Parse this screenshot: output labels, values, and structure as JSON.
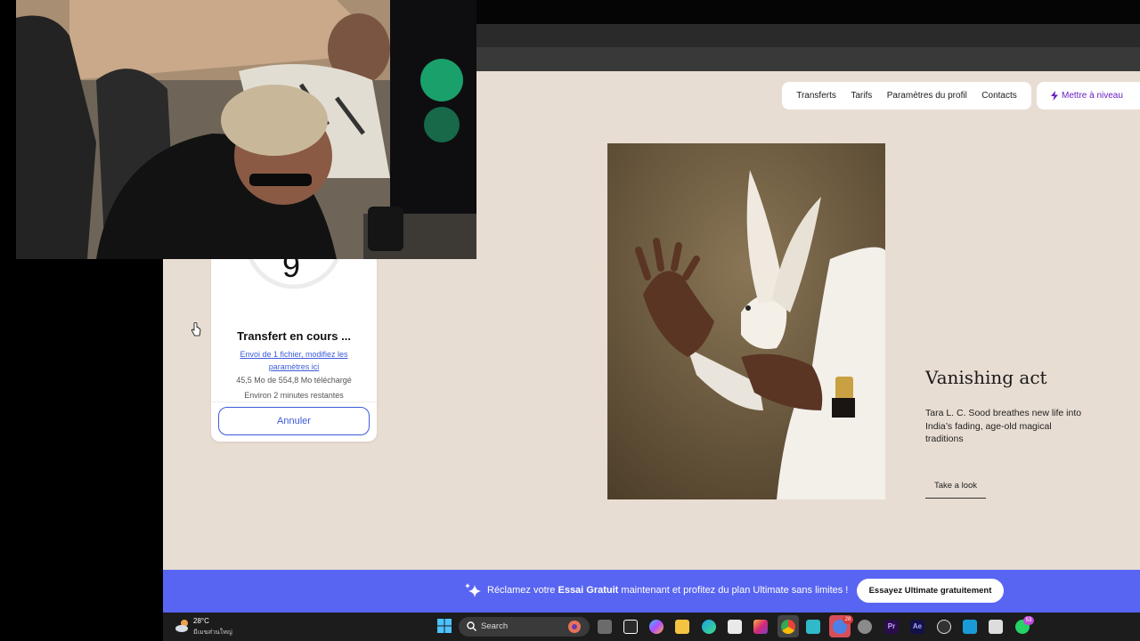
{
  "nav": {
    "items": [
      "Transferts",
      "Tarifs",
      "Paramètres du profil",
      "Contacts"
    ],
    "upgrade_label": "Mettre à niveau"
  },
  "transfer_card": {
    "percent": "9",
    "progress_fraction": 0.09,
    "title": "Transfert en cours ...",
    "link": "Envoi de 1 fichier, modifiez les paramètres ici",
    "uploaded": "45,5 Mo de 554,8 Mo téléchargé",
    "remaining": "Environ 2 minutes restantes",
    "cancel_label": "Annuler"
  },
  "article": {
    "title": "Vanishing act",
    "description": "Tara L. C. Sood breathes new life into India’s fading, age-old magical traditions",
    "cta": "Take a look"
  },
  "banner": {
    "text_before": "Réclamez votre ",
    "text_bold": "Essai Gratuit",
    "text_after": " maintenant et profitez du plan Ultimate sans limites !",
    "button_label": "Essayez Ultimate gratuitement"
  },
  "taskbar": {
    "weather_temp": "28°C",
    "weather_desc": "มีเมฆส่วนใหญ่",
    "search_placeholder": "Search",
    "whatsapp_badge": "53",
    "active_app_badge": "28"
  },
  "colors": {
    "page_bg": "#e8ddd2",
    "accent_blue": "#3d5bd9",
    "banner_bg": "#5865f2",
    "upgrade_purple": "#6a1fc0"
  }
}
